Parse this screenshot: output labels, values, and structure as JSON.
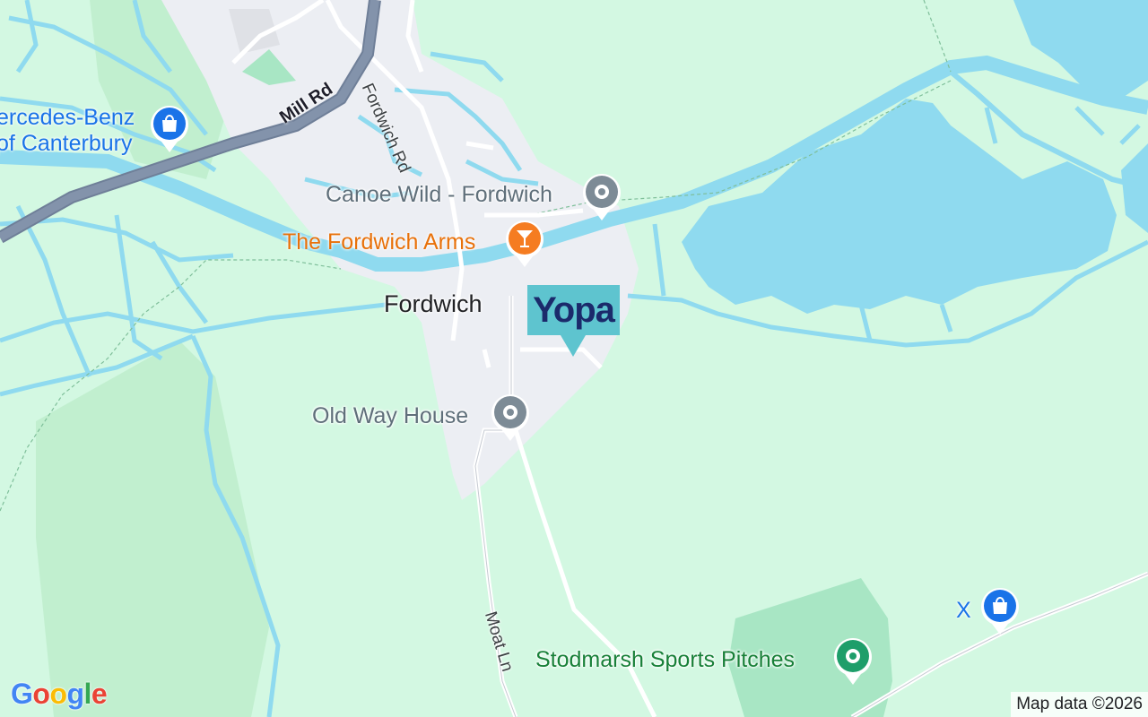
{
  "map": {
    "colors": {
      "land": "#d3f8e2",
      "water": "#8fdaef",
      "village": "#eceef3",
      "park": "#a8e6c4",
      "major_road": "#8393ab"
    },
    "labels": {
      "mercedes": "ercedes-Benz\nof Canterbury",
      "mercedes_line1": "ercedes-Benz",
      "mercedes_line2": "of Canterbury",
      "canoe": "Canoe Wild - Fordwich",
      "arms": "The Fordwich Arms",
      "town": "Fordwich",
      "old_way": "Old Way House",
      "sports": "Stodmarsh Sports Pitches",
      "x_shop": "X",
      "mill_rd": "Mill Rd",
      "fordwich_rd": "Fordwich Rd",
      "moat_ln": "Moat Ln"
    },
    "icons": {
      "mercedes": "shopping-bag-icon",
      "canoe": "place-icon",
      "arms": "cocktail-icon",
      "old_way": "place-icon",
      "sports": "place-icon",
      "x_shop": "shopping-bag-icon"
    },
    "brand_marker": "Yopa"
  },
  "footer": {
    "google": [
      "G",
      "o",
      "o",
      "g",
      "l",
      "e"
    ],
    "attribution": "Map data ©2026"
  }
}
